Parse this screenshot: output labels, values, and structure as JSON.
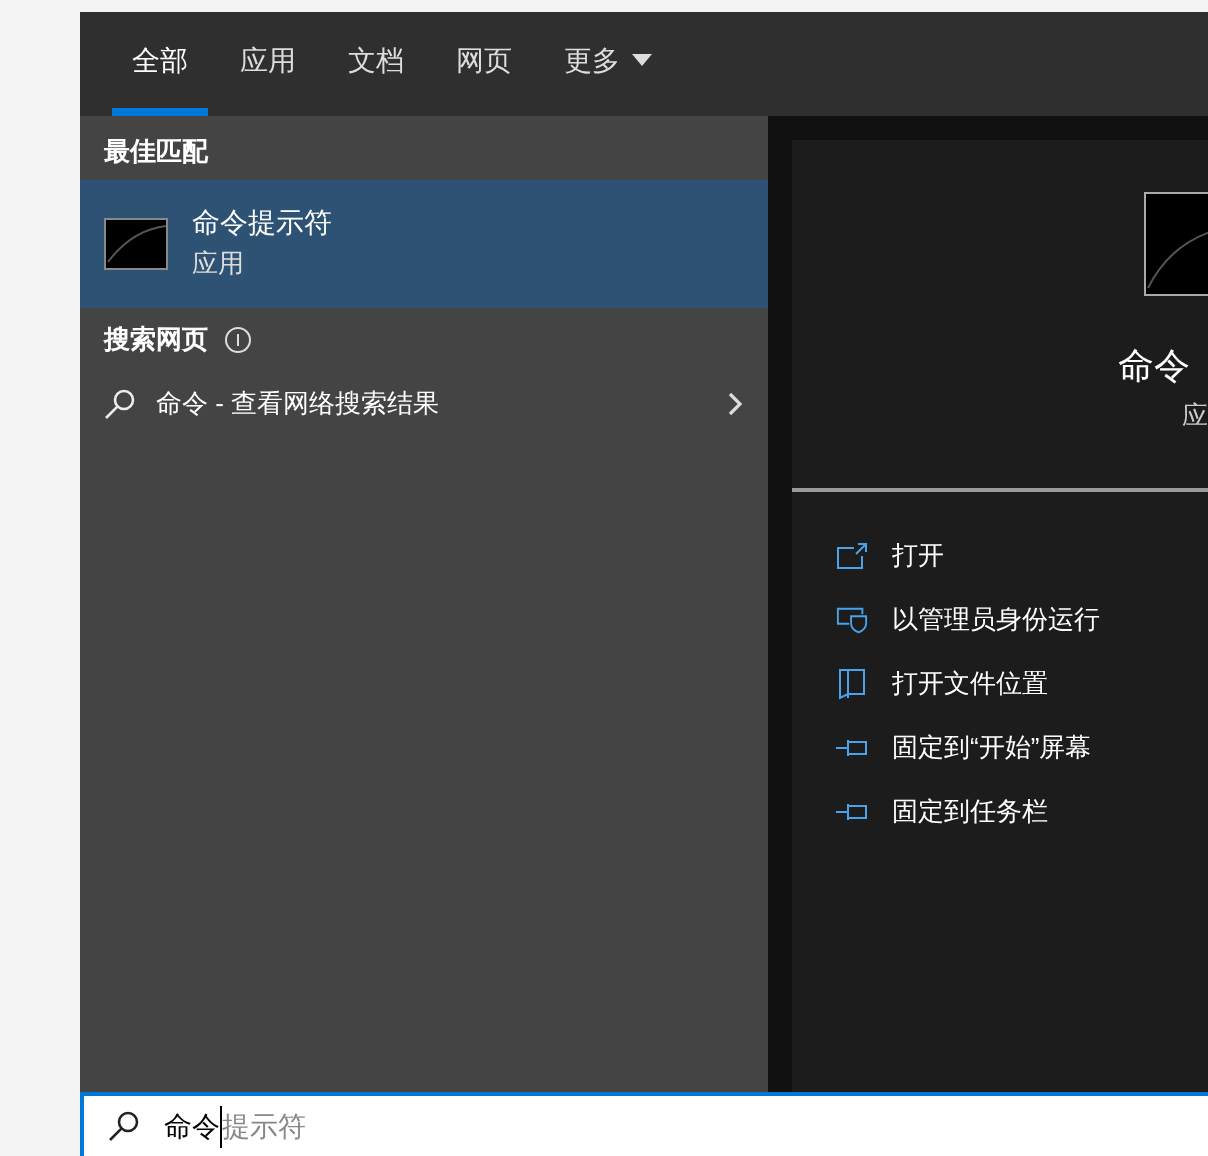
{
  "tabs": [
    {
      "label": "全部",
      "selected": true
    },
    {
      "label": "应用",
      "selected": false
    },
    {
      "label": "文档",
      "selected": false
    },
    {
      "label": "网页",
      "selected": false
    },
    {
      "label": "更多",
      "selected": false,
      "dropdown": true
    }
  ],
  "best_match": {
    "heading": "最佳匹配",
    "item": {
      "title": "命令提示符",
      "subtitle": "应用",
      "selected": true
    }
  },
  "web_search": {
    "heading": "搜索网页",
    "item": {
      "query": "命令",
      "suffix": " - 查看网络搜索结果"
    }
  },
  "preview": {
    "title": "命令",
    "subtitle": "应"
  },
  "actions": [
    {
      "kind": "open",
      "label": "打开"
    },
    {
      "kind": "admin",
      "label": "以管理员身份运行"
    },
    {
      "kind": "file",
      "label": "打开文件位置"
    },
    {
      "kind": "pin",
      "label": "固定到“开始”屏幕"
    },
    {
      "kind": "pin",
      "label": "固定到任务栏"
    }
  ],
  "search": {
    "value": "命令",
    "suggestion": "提示符"
  }
}
